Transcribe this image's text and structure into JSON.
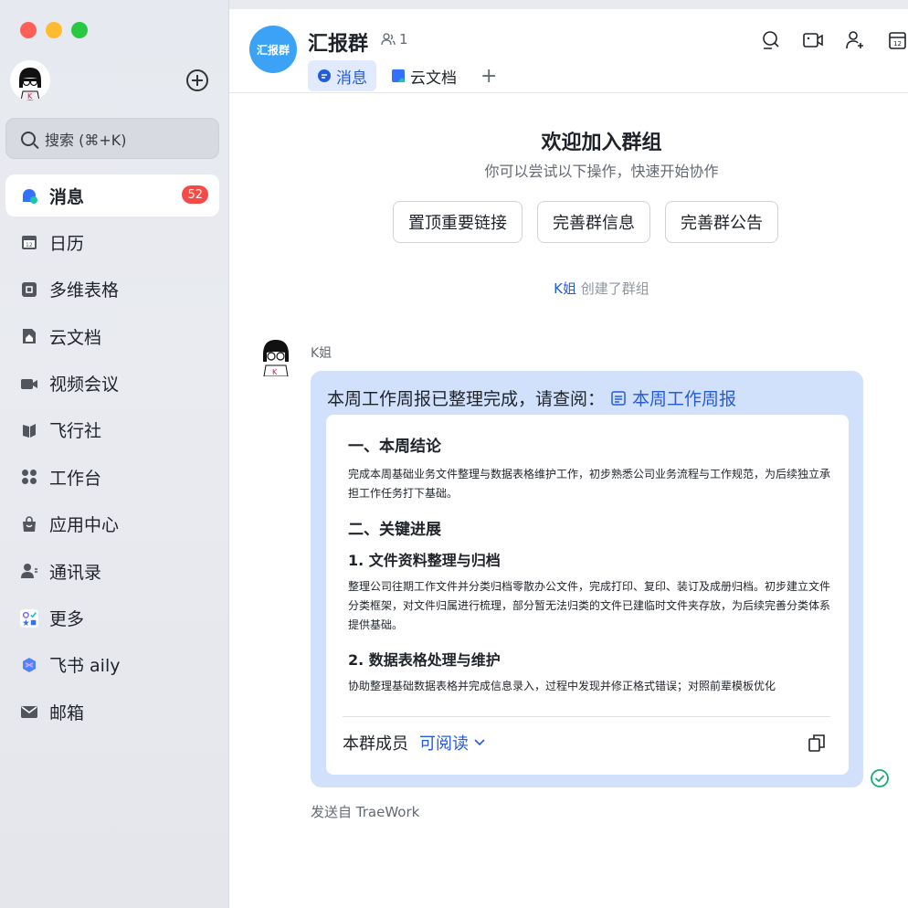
{
  "colors": {
    "accent": "#245bdb",
    "badge": "#f54a45",
    "group_avatar": "#3ba2f5",
    "bubble": "#d1e1fc"
  },
  "sidebar": {
    "search": {
      "placeholder": "搜索 (⌘+K)"
    },
    "items": [
      {
        "label": "消息",
        "icon": "message-icon",
        "badge": "52",
        "active": true
      },
      {
        "label": "日历",
        "icon": "calendar-icon"
      },
      {
        "label": "多维表格",
        "icon": "base-icon"
      },
      {
        "label": "云文档",
        "icon": "docs-icon"
      },
      {
        "label": "视频会议",
        "icon": "video-meeting-icon"
      },
      {
        "label": "飞行社",
        "icon": "flight-club-icon"
      },
      {
        "label": "工作台",
        "icon": "workplace-icon"
      },
      {
        "label": "应用中心",
        "icon": "app-center-icon"
      },
      {
        "label": "通讯录",
        "icon": "contacts-icon"
      },
      {
        "label": "更多",
        "icon": "more-icon"
      },
      {
        "label": "飞书 aily",
        "icon": "aily-icon"
      },
      {
        "label": "邮箱",
        "icon": "mail-icon"
      }
    ]
  },
  "header": {
    "avatar_text": "汇报群",
    "group_name": "汇报群",
    "member_count": "1",
    "tabs": [
      {
        "label": "消息",
        "icon": "message-icon",
        "active": true
      },
      {
        "label": "云文档",
        "icon": "docs-icon"
      }
    ],
    "tab_add": "+"
  },
  "welcome": {
    "title": "欢迎加入群组",
    "subtitle": "你可以尝试以下操作，快速开始协作",
    "actions": [
      "置顶重要链接",
      "完善群信息",
      "完善群公告"
    ],
    "system_who": "K姐",
    "system_text": "创建了群组"
  },
  "message": {
    "sender": "K姐",
    "text": "本周工作周报已整理完成，请查阅：",
    "doc_title": "本周工作周报",
    "card": {
      "h1": "一、本周结论",
      "p1": "完成本周基础业务文件整理与数据表格维护工作，初步熟悉公司业务流程与工作规范，为后续独立承担工作任务打下基础。",
      "h2": "二、关键进展",
      "s1_title": "1. 文件资料整理与归档",
      "s1_text": "整理公司往期工作文件并分类归档零散办公文件，完成打印、复印、装订及成册归档。初步建立文件分类框架，对文件归属进行梳理，部分暂无法归类的文件已建临时文件夹存放，为后续完善分类体系提供基础。",
      "s2_title": "2. 数据表格处理与维护",
      "s2_text": "协助整理基础数据表格并完成信息录入，过程中发现并修正格式错误；对照前辈模板优化",
      "footer_label": "本群成员",
      "footer_perm": "可阅读"
    },
    "sent_from": "发送自 TraeWork"
  }
}
